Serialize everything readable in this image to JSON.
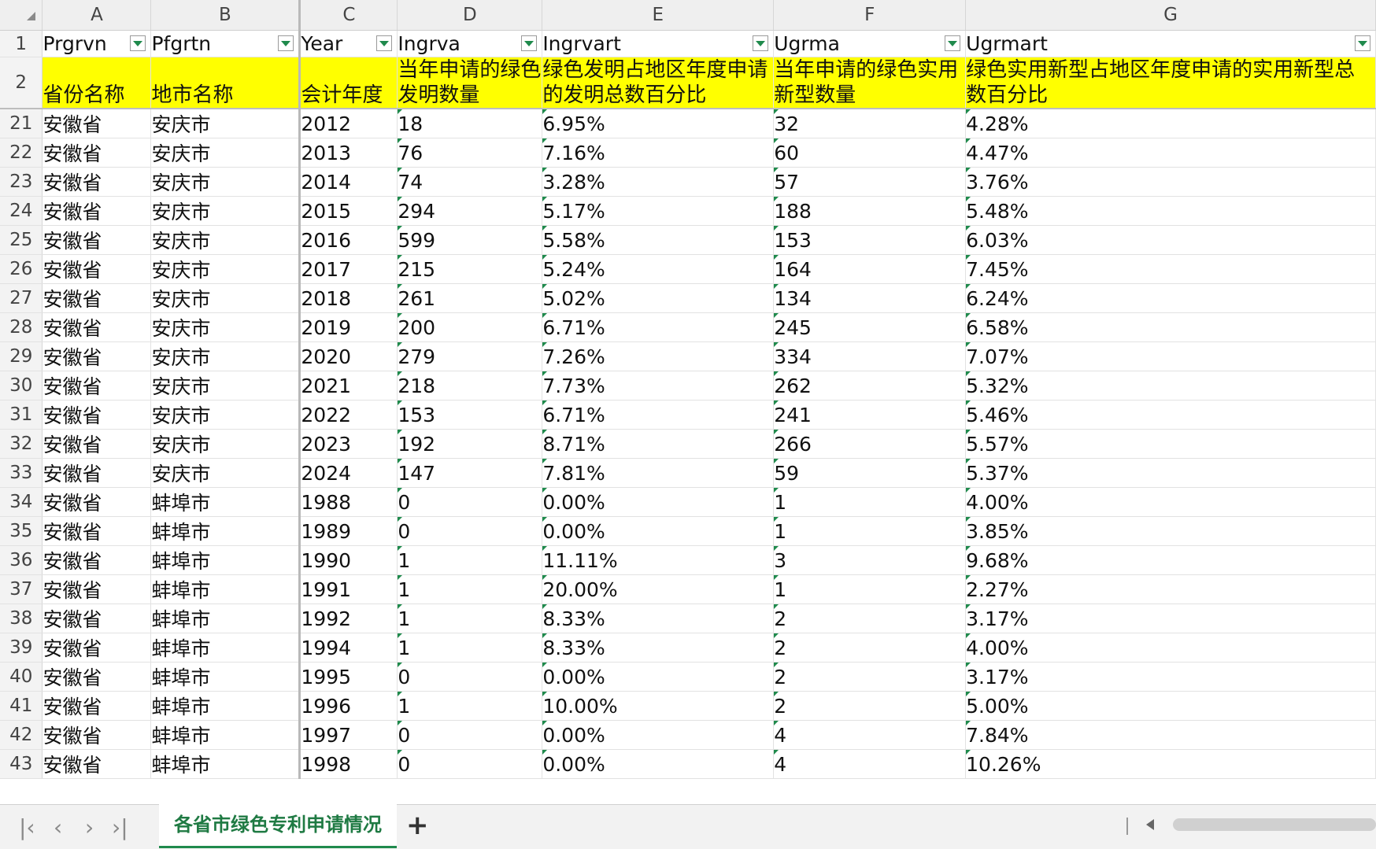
{
  "columns": [
    "A",
    "B",
    "C",
    "D",
    "E",
    "F",
    "G"
  ],
  "header_row": {
    "num": "1",
    "cells": [
      "Prgrvn",
      "Pfgrtn",
      "Year",
      "Ingrva",
      "Ingrvart",
      "Ugrma",
      "Ugrmart"
    ]
  },
  "desc_row": {
    "num": "2",
    "cells": [
      "省份名称",
      "地市名称",
      "会计年度",
      "当年申请的绿色发明数量",
      "绿色发明占地区年度申请的发明总数百分比",
      "当年申请的绿色实用新型数量",
      "绿色实用新型占地区年度申请的实用新型总数百分比"
    ]
  },
  "rows": [
    {
      "num": "21",
      "cells": [
        "安徽省",
        "安庆市",
        "2012",
        "18",
        "6.95%",
        "32",
        "4.28%"
      ]
    },
    {
      "num": "22",
      "cells": [
        "安徽省",
        "安庆市",
        "2013",
        "76",
        "7.16%",
        "60",
        "4.47%"
      ]
    },
    {
      "num": "23",
      "cells": [
        "安徽省",
        "安庆市",
        "2014",
        "74",
        "3.28%",
        "57",
        "3.76%"
      ]
    },
    {
      "num": "24",
      "cells": [
        "安徽省",
        "安庆市",
        "2015",
        "294",
        "5.17%",
        "188",
        "5.48%"
      ]
    },
    {
      "num": "25",
      "cells": [
        "安徽省",
        "安庆市",
        "2016",
        "599",
        "5.58%",
        "153",
        "6.03%"
      ]
    },
    {
      "num": "26",
      "cells": [
        "安徽省",
        "安庆市",
        "2017",
        "215",
        "5.24%",
        "164",
        "7.45%"
      ]
    },
    {
      "num": "27",
      "cells": [
        "安徽省",
        "安庆市",
        "2018",
        "261",
        "5.02%",
        "134",
        "6.24%"
      ]
    },
    {
      "num": "28",
      "cells": [
        "安徽省",
        "安庆市",
        "2019",
        "200",
        "6.71%",
        "245",
        "6.58%"
      ]
    },
    {
      "num": "29",
      "cells": [
        "安徽省",
        "安庆市",
        "2020",
        "279",
        "7.26%",
        "334",
        "7.07%"
      ]
    },
    {
      "num": "30",
      "cells": [
        "安徽省",
        "安庆市",
        "2021",
        "218",
        "7.73%",
        "262",
        "5.32%"
      ]
    },
    {
      "num": "31",
      "cells": [
        "安徽省",
        "安庆市",
        "2022",
        "153",
        "6.71%",
        "241",
        "5.46%"
      ]
    },
    {
      "num": "32",
      "cells": [
        "安徽省",
        "安庆市",
        "2023",
        "192",
        "8.71%",
        "266",
        "5.57%"
      ]
    },
    {
      "num": "33",
      "cells": [
        "安徽省",
        "安庆市",
        "2024",
        "147",
        "7.81%",
        "59",
        "5.37%"
      ]
    },
    {
      "num": "34",
      "cells": [
        "安徽省",
        "蚌埠市",
        "1988",
        "0",
        "0.00%",
        "1",
        "4.00%"
      ]
    },
    {
      "num": "35",
      "cells": [
        "安徽省",
        "蚌埠市",
        "1989",
        "0",
        "0.00%",
        "1",
        "3.85%"
      ]
    },
    {
      "num": "36",
      "cells": [
        "安徽省",
        "蚌埠市",
        "1990",
        "1",
        "11.11%",
        "3",
        "9.68%"
      ]
    },
    {
      "num": "37",
      "cells": [
        "安徽省",
        "蚌埠市",
        "1991",
        "1",
        "20.00%",
        "1",
        "2.27%"
      ]
    },
    {
      "num": "38",
      "cells": [
        "安徽省",
        "蚌埠市",
        "1992",
        "1",
        "8.33%",
        "2",
        "3.17%"
      ]
    },
    {
      "num": "39",
      "cells": [
        "安徽省",
        "蚌埠市",
        "1994",
        "1",
        "8.33%",
        "2",
        "4.00%"
      ]
    },
    {
      "num": "40",
      "cells": [
        "安徽省",
        "蚌埠市",
        "1995",
        "0",
        "0.00%",
        "2",
        "3.17%"
      ]
    },
    {
      "num": "41",
      "cells": [
        "安徽省",
        "蚌埠市",
        "1996",
        "1",
        "10.00%",
        "2",
        "5.00%"
      ]
    },
    {
      "num": "42",
      "cells": [
        "安徽省",
        "蚌埠市",
        "1997",
        "0",
        "0.00%",
        "4",
        "7.84%"
      ]
    },
    {
      "num": "43",
      "cells": [
        "安徽省",
        "蚌埠市",
        "1998",
        "0",
        "0.00%",
        "4",
        "10.26%"
      ]
    }
  ],
  "sheet_tab": "各省市绿色专利申请情况",
  "nav": {
    "first": "|<",
    "prev": "<",
    "next": ">",
    "last": ">|",
    "add": "+"
  },
  "accent_color": "#1f8a4c",
  "header_fill_color": "#ffff00"
}
